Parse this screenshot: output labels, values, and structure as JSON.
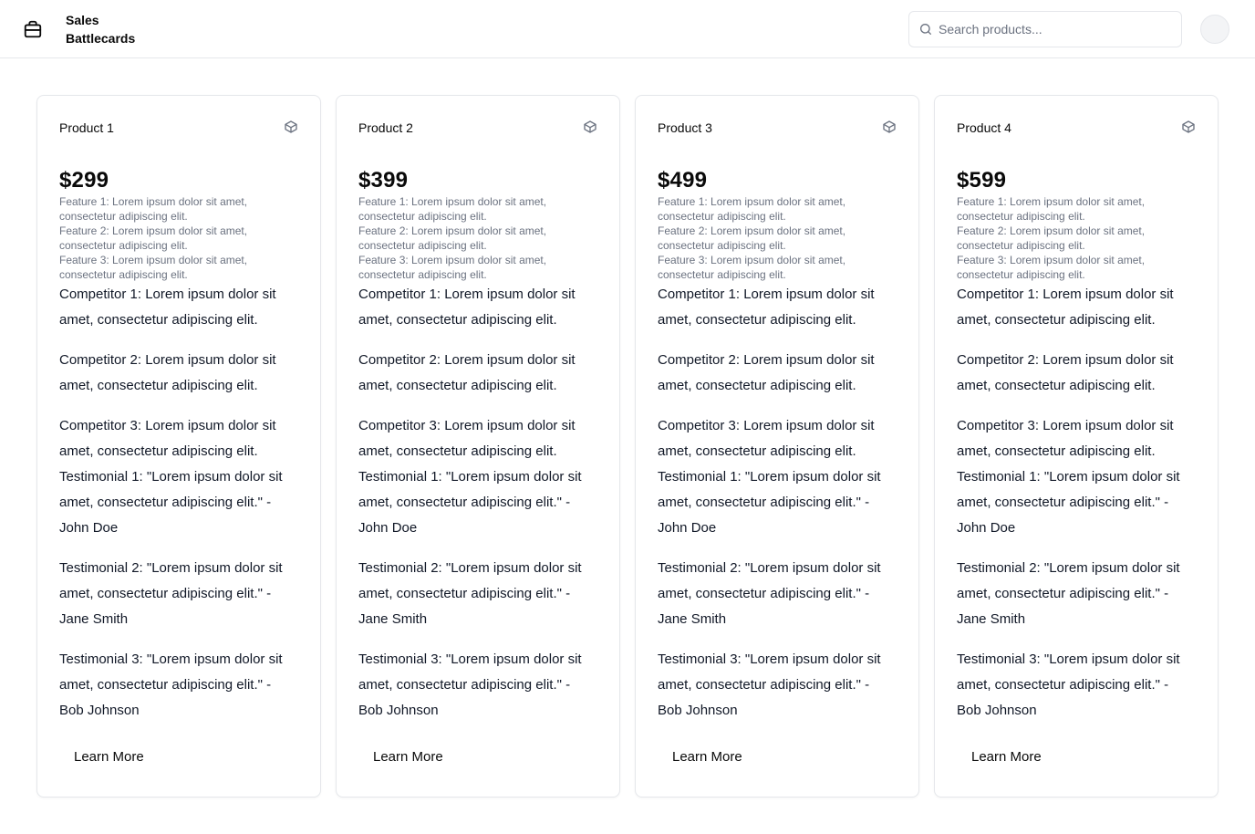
{
  "header": {
    "title": "Sales Battlecards",
    "logo_icon": "briefcase-icon",
    "search": {
      "placeholder": "Search products...",
      "value": ""
    },
    "avatar": "user-avatar"
  },
  "products": [
    {
      "title": "Product 1",
      "icon": "box-icon",
      "price": "$299",
      "features": [
        "Feature 1: Lorem ipsum dolor sit amet, consectetur adipiscing elit.",
        "Feature 2: Lorem ipsum dolor sit amet, consectetur adipiscing elit.",
        "Feature 3: Lorem ipsum dolor sit amet, consectetur adipiscing elit."
      ],
      "competitors": [
        "Competitor 1: Lorem ipsum dolor sit amet, consectetur adipiscing elit.",
        "Competitor 2: Lorem ipsum dolor sit amet, consectetur adipiscing elit.",
        "Competitor 3: Lorem ipsum dolor sit amet, consectetur adipiscing elit."
      ],
      "testimonials": [
        "Testimonial 1: \"Lorem ipsum dolor sit amet, consectetur adipiscing elit.\" - John Doe",
        "Testimonial 2: \"Lorem ipsum dolor sit amet, consectetur adipiscing elit.\" - Jane Smith",
        "Testimonial 3: \"Lorem ipsum dolor sit amet, consectetur adipiscing elit.\" - Bob Johnson"
      ],
      "button": "Learn More"
    },
    {
      "title": "Product 2",
      "icon": "box-icon",
      "price": "$399",
      "features": [
        "Feature 1: Lorem ipsum dolor sit amet, consectetur adipiscing elit.",
        "Feature 2: Lorem ipsum dolor sit amet, consectetur adipiscing elit.",
        "Feature 3: Lorem ipsum dolor sit amet, consectetur adipiscing elit."
      ],
      "competitors": [
        "Competitor 1: Lorem ipsum dolor sit amet, consectetur adipiscing elit.",
        "Competitor 2: Lorem ipsum dolor sit amet, consectetur adipiscing elit.",
        "Competitor 3: Lorem ipsum dolor sit amet, consectetur adipiscing elit."
      ],
      "testimonials": [
        "Testimonial 1: \"Lorem ipsum dolor sit amet, consectetur adipiscing elit.\" - John Doe",
        "Testimonial 2: \"Lorem ipsum dolor sit amet, consectetur adipiscing elit.\" - Jane Smith",
        "Testimonial 3: \"Lorem ipsum dolor sit amet, consectetur adipiscing elit.\" - Bob Johnson"
      ],
      "button": "Learn More"
    },
    {
      "title": "Product 3",
      "icon": "box-icon",
      "price": "$499",
      "features": [
        "Feature 1: Lorem ipsum dolor sit amet, consectetur adipiscing elit.",
        "Feature 2: Lorem ipsum dolor sit amet, consectetur adipiscing elit.",
        "Feature 3: Lorem ipsum dolor sit amet, consectetur adipiscing elit."
      ],
      "competitors": [
        "Competitor 1: Lorem ipsum dolor sit amet, consectetur adipiscing elit.",
        "Competitor 2: Lorem ipsum dolor sit amet, consectetur adipiscing elit.",
        "Competitor 3: Lorem ipsum dolor sit amet, consectetur adipiscing elit."
      ],
      "testimonials": [
        "Testimonial 1: \"Lorem ipsum dolor sit amet, consectetur adipiscing elit.\" - John Doe",
        "Testimonial 2: \"Lorem ipsum dolor sit amet, consectetur adipiscing elit.\" - Jane Smith",
        "Testimonial 3: \"Lorem ipsum dolor sit amet, consectetur adipiscing elit.\" - Bob Johnson"
      ],
      "button": "Learn More"
    },
    {
      "title": "Product 4",
      "icon": "box-icon",
      "price": "$599",
      "features": [
        "Feature 1: Lorem ipsum dolor sit amet, consectetur adipiscing elit.",
        "Feature 2: Lorem ipsum dolor sit amet, consectetur adipiscing elit.",
        "Feature 3: Lorem ipsum dolor sit amet, consectetur adipiscing elit."
      ],
      "competitors": [
        "Competitor 1: Lorem ipsum dolor sit amet, consectetur adipiscing elit.",
        "Competitor 2: Lorem ipsum dolor sit amet, consectetur adipiscing elit.",
        "Competitor 3: Lorem ipsum dolor sit amet, consectetur adipiscing elit."
      ],
      "testimonials": [
        "Testimonial 1: \"Lorem ipsum dolor sit amet, consectetur adipiscing elit.\" - John Doe",
        "Testimonial 2: \"Lorem ipsum dolor sit amet, consectetur adipiscing elit.\" - Jane Smith",
        "Testimonial 3: \"Lorem ipsum dolor sit amet, consectetur adipiscing elit.\" - Bob Johnson"
      ],
      "button": "Learn More"
    }
  ]
}
